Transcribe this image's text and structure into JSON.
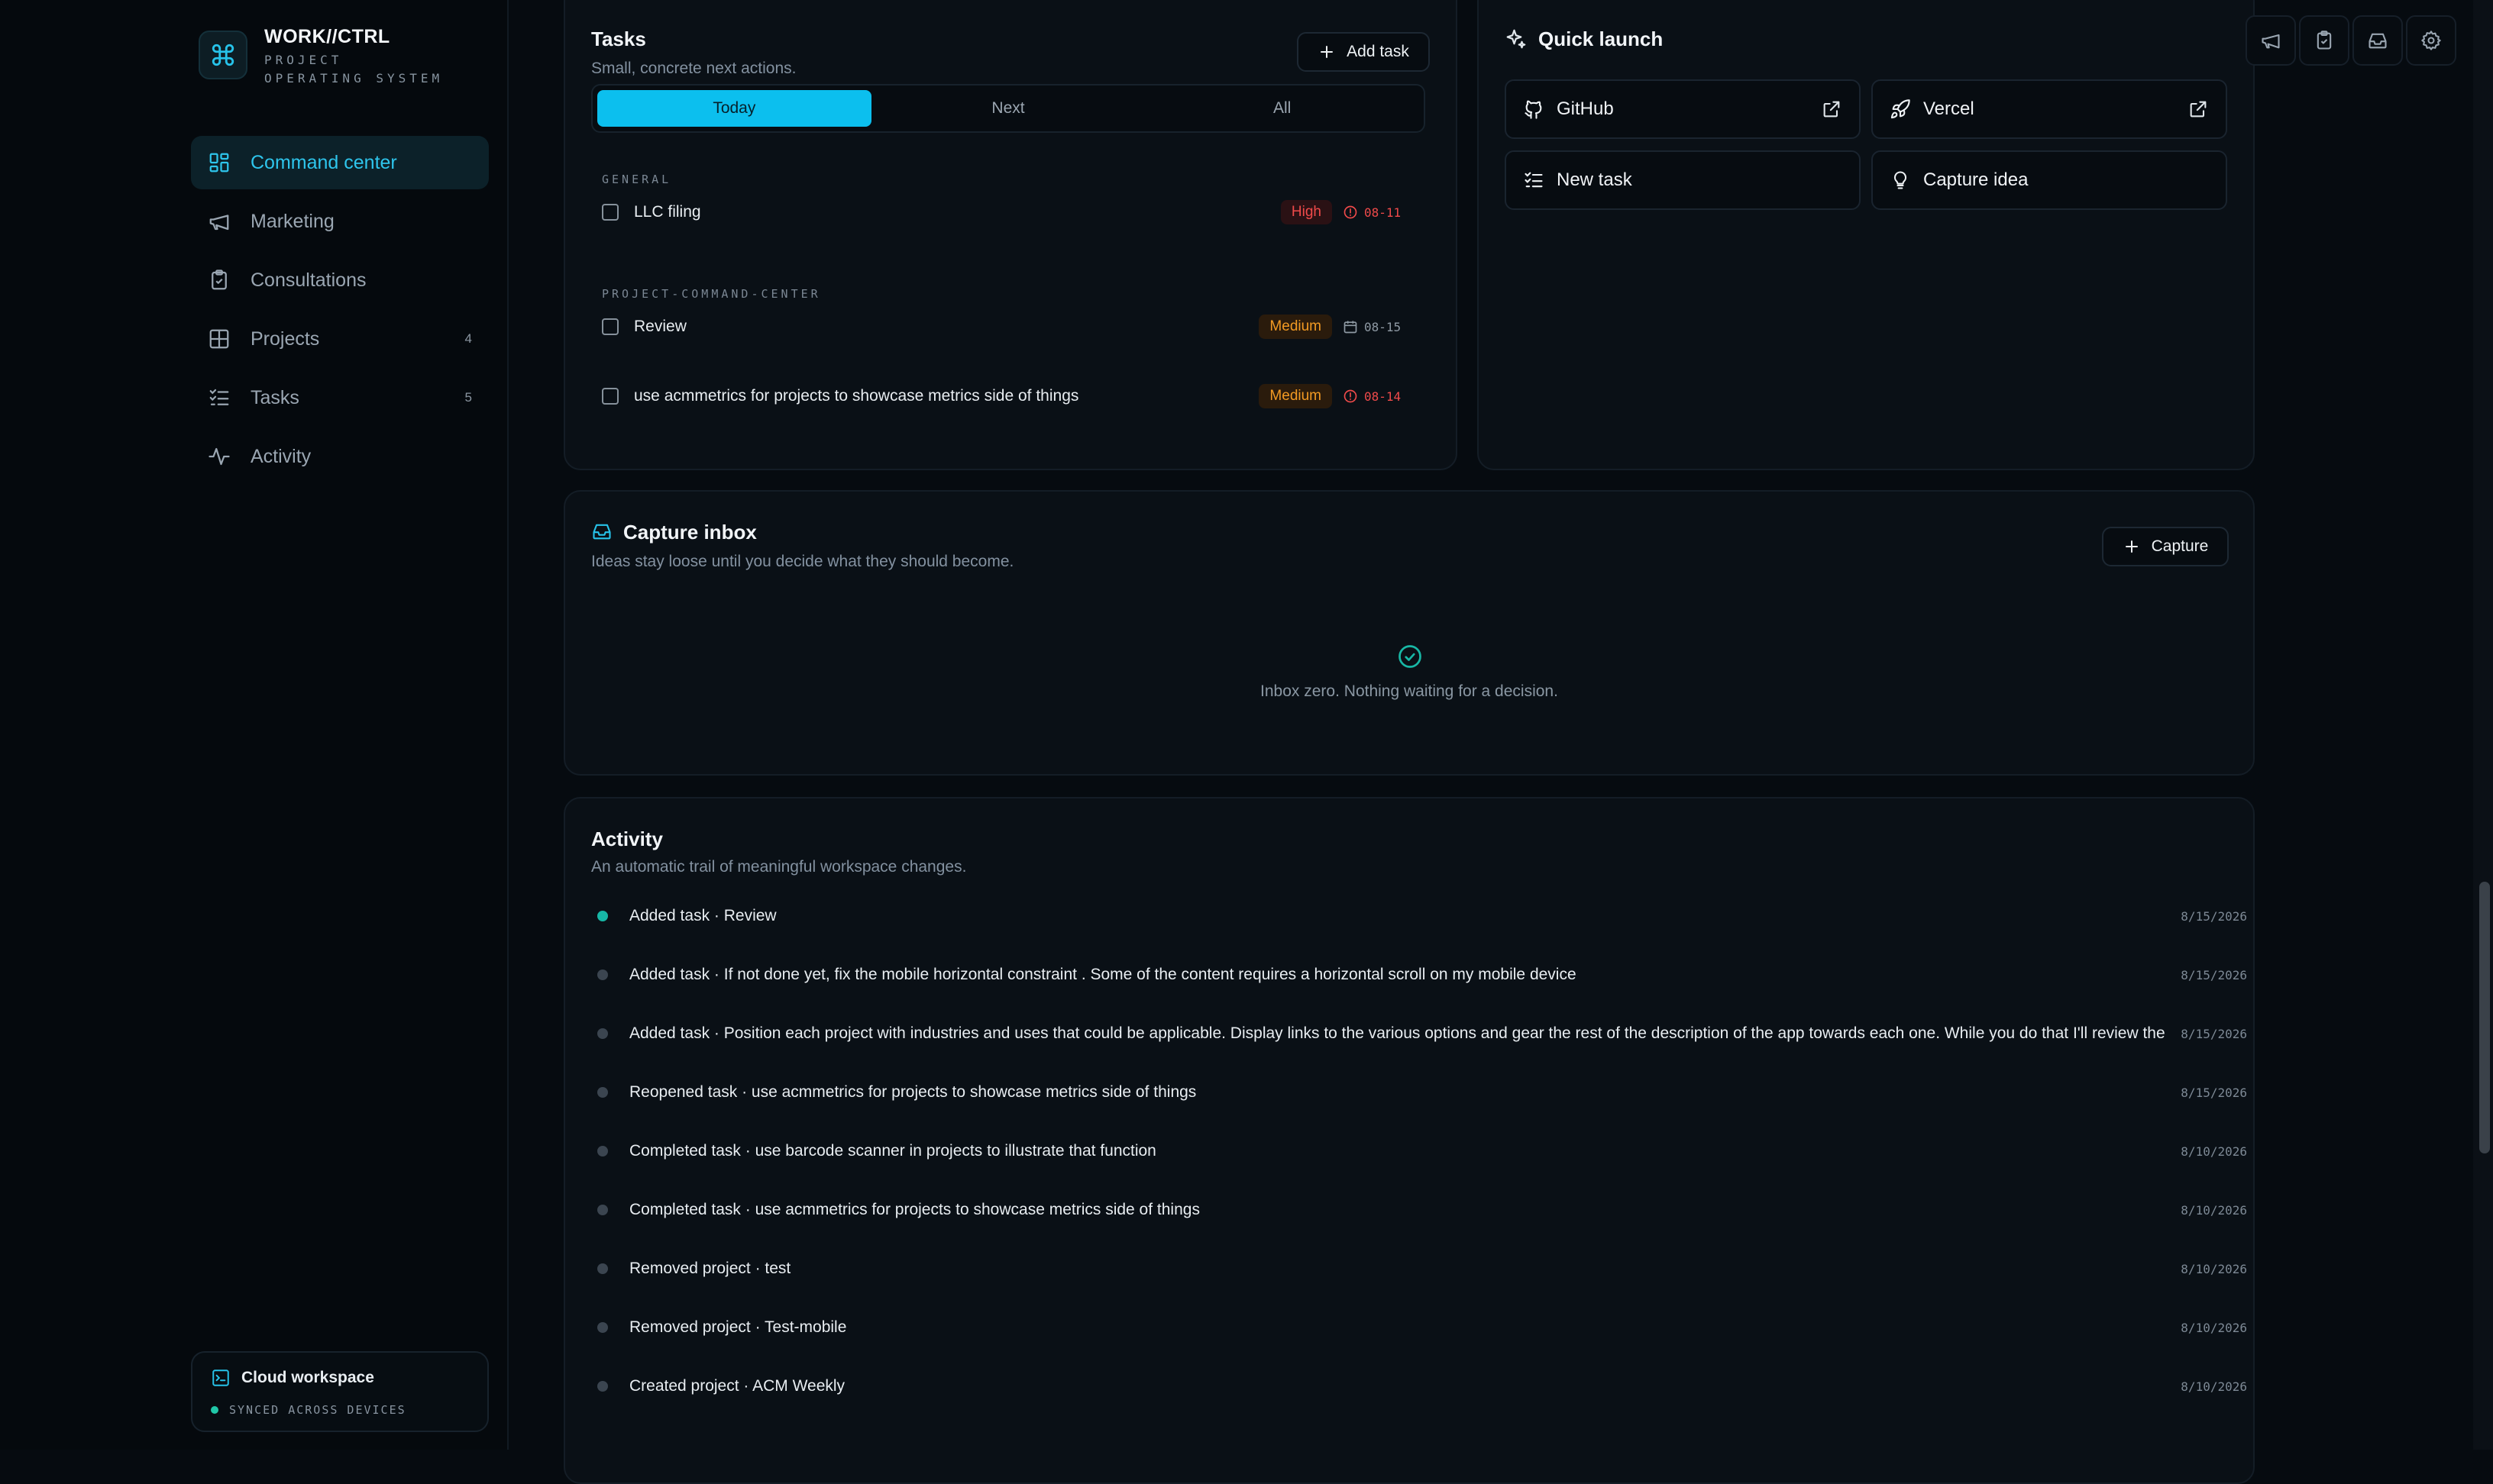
{
  "brand": {
    "name": "WORK//CTRL",
    "subtitle": "PROJECT OPERATING SYSTEM",
    "logo_icon": "command-icon"
  },
  "nav": {
    "items": [
      {
        "label": "Command center",
        "icon": "dashboard-icon",
        "count": "",
        "active": true
      },
      {
        "label": "Marketing",
        "icon": "megaphone-icon",
        "count": ""
      },
      {
        "label": "Consultations",
        "icon": "clipboard-icon",
        "count": ""
      },
      {
        "label": "Projects",
        "icon": "grid-icon",
        "count": "4"
      },
      {
        "label": "Tasks",
        "icon": "checklist-icon",
        "count": "5"
      },
      {
        "label": "Activity",
        "icon": "pulse-icon",
        "count": ""
      }
    ]
  },
  "cloud": {
    "title": "Cloud workspace",
    "status": "SYNCED ACROSS DEVICES"
  },
  "tasks": {
    "title": "Tasks",
    "subtitle": "Small, concrete next actions.",
    "add_label": "Add task",
    "tabs": [
      "Today",
      "Next",
      "All"
    ],
    "active_tab": "Today",
    "groups": [
      {
        "label": "GENERAL",
        "items": [
          {
            "label": "LLC filing",
            "priority": "High",
            "due": "08-11",
            "overdue": true
          }
        ]
      },
      {
        "label": "PROJECT-COMMAND-CENTER",
        "items": [
          {
            "label": "Review",
            "priority": "Medium",
            "due": "08-15",
            "overdue": false
          },
          {
            "label": "use acmmetrics for projects to showcase metrics side of things",
            "priority": "Medium",
            "due": "08-14",
            "overdue": true
          }
        ]
      }
    ]
  },
  "quick_launch": {
    "title": "Quick launch",
    "items": [
      {
        "label": "GitHub",
        "icon": "github-icon",
        "external": true
      },
      {
        "label": "Vercel",
        "icon": "rocket-icon",
        "external": true
      },
      {
        "label": "New task",
        "icon": "checklist-icon",
        "external": false
      },
      {
        "label": "Capture idea",
        "icon": "lightbulb-icon",
        "external": false
      }
    ]
  },
  "capture": {
    "title": "Capture inbox",
    "subtitle": "Ideas stay loose until you decide what they should become.",
    "button_label": "Capture",
    "empty_text": "Inbox zero. Nothing waiting for a decision."
  },
  "activity": {
    "title": "Activity",
    "subtitle": "An automatic trail of meaningful workspace changes.",
    "items": [
      {
        "text": "Added task · Review",
        "date": "8/15/2026",
        "accent": true
      },
      {
        "text": "Added task · If not done yet, fix the mobile horizontal constraint . Some of the content requires a horizontal scroll on my mobile device",
        "date": "8/15/2026"
      },
      {
        "text": "Added task · Position each project with industries and uses that could be applicable. Display links to the various options and gear the rest of the description of the app towards each one. While you do that I'll review the",
        "date": "8/15/2026"
      },
      {
        "text": "Reopened task · use acmmetrics for projects to showcase metrics side of things",
        "date": "8/15/2026"
      },
      {
        "text": "Completed task · use barcode scanner in projects to illustrate that function",
        "date": "8/10/2026"
      },
      {
        "text": "Completed task · use acmmetrics for projects to showcase metrics side of things",
        "date": "8/10/2026"
      },
      {
        "text": "Removed project · test",
        "date": "8/10/2026"
      },
      {
        "text": "Removed project · Test-mobile",
        "date": "8/10/2026"
      },
      {
        "text": "Created project · ACM Weekly",
        "date": "8/10/2026"
      }
    ]
  },
  "topbar": {
    "icons": [
      "megaphone-icon",
      "clipboard-icon",
      "inbox-icon",
      "gear-icon"
    ]
  },
  "colors": {
    "accent": "#0cbfee",
    "high": "#ef4a4a",
    "medium": "#f29a23",
    "success": "#20c7a8"
  }
}
